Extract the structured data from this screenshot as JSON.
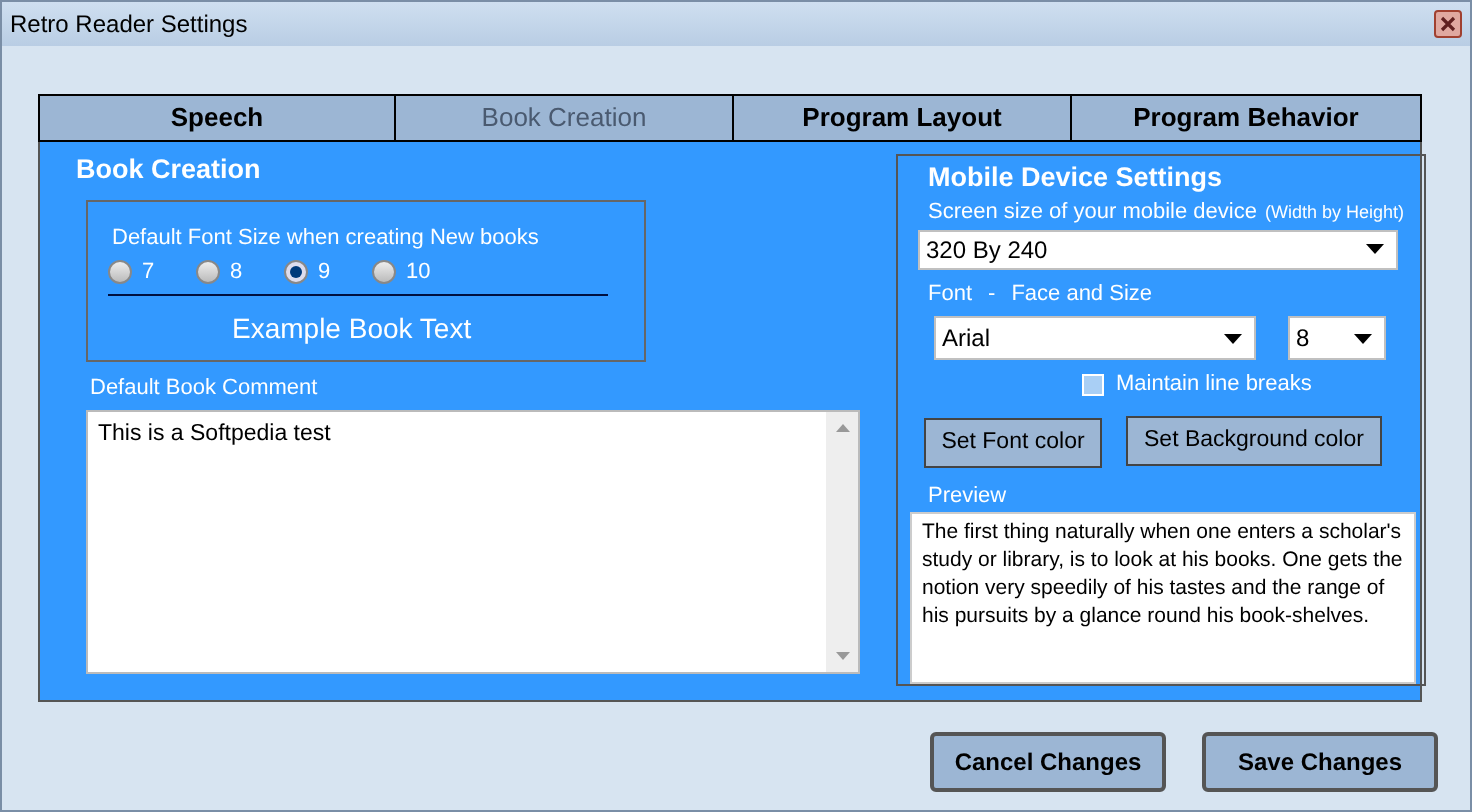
{
  "window": {
    "title": "Retro Reader Settings"
  },
  "tabs": [
    {
      "label": "Speech",
      "selected": false
    },
    {
      "label": "Book Creation",
      "selected": true
    },
    {
      "label": "Program Layout",
      "selected": false
    },
    {
      "label": "Program Behavior",
      "selected": false
    }
  ],
  "book_creation": {
    "heading": "Book Creation",
    "font_size_label": "Default Font Size when creating New books",
    "font_sizes": [
      {
        "label": "7",
        "selected": false
      },
      {
        "label": "8",
        "selected": false
      },
      {
        "label": "9",
        "selected": true
      },
      {
        "label": "10",
        "selected": false
      }
    ],
    "example_text": "Example Book Text",
    "comment_label": "Default Book Comment",
    "comment": "This is a Softpedia test"
  },
  "mobile": {
    "heading": "Mobile Device Settings",
    "screen_size_label": "Screen size of your mobile device",
    "screen_size_hint": "(Width by Height)",
    "screen_size": "320 By 240",
    "font_label": "Font",
    "font_sep": "-",
    "font_sub_label": "Face and Size",
    "font_face": "Arial",
    "font_size": "8",
    "maintain_line_breaks": {
      "label": "Maintain line breaks",
      "checked": false
    },
    "buttons": [
      "Set Font color",
      "Set Background color"
    ],
    "preview_label": "Preview",
    "preview": "The first thing naturally when one enters a scholar's study or library, is to look at his books. One gets the notion very speedily of his tastes and the range of his pursuits by a glance round his book-shelves."
  },
  "buttons": [
    "Cancel Changes",
    "Save Changes"
  ]
}
